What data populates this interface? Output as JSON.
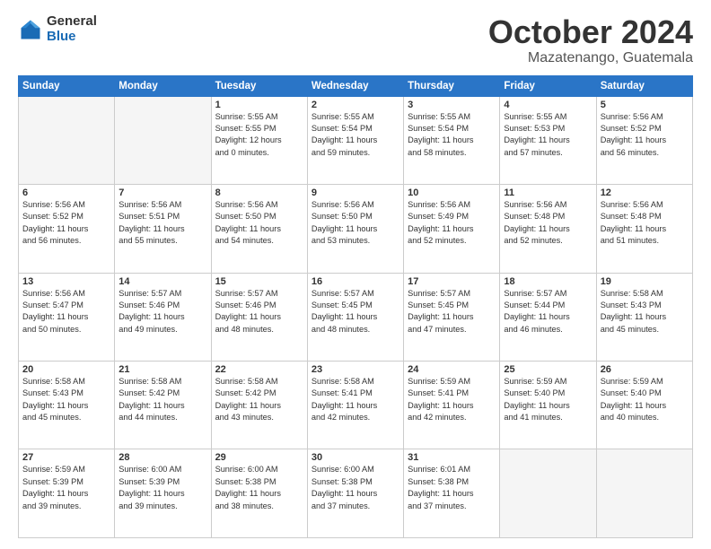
{
  "header": {
    "logo_general": "General",
    "logo_blue": "Blue",
    "month": "October 2024",
    "location": "Mazatenango, Guatemala"
  },
  "weekdays": [
    "Sunday",
    "Monday",
    "Tuesday",
    "Wednesday",
    "Thursday",
    "Friday",
    "Saturday"
  ],
  "weeks": [
    [
      {
        "day": "",
        "info": ""
      },
      {
        "day": "",
        "info": ""
      },
      {
        "day": "1",
        "info": "Sunrise: 5:55 AM\nSunset: 5:55 PM\nDaylight: 12 hours\nand 0 minutes."
      },
      {
        "day": "2",
        "info": "Sunrise: 5:55 AM\nSunset: 5:54 PM\nDaylight: 11 hours\nand 59 minutes."
      },
      {
        "day": "3",
        "info": "Sunrise: 5:55 AM\nSunset: 5:54 PM\nDaylight: 11 hours\nand 58 minutes."
      },
      {
        "day": "4",
        "info": "Sunrise: 5:55 AM\nSunset: 5:53 PM\nDaylight: 11 hours\nand 57 minutes."
      },
      {
        "day": "5",
        "info": "Sunrise: 5:56 AM\nSunset: 5:52 PM\nDaylight: 11 hours\nand 56 minutes."
      }
    ],
    [
      {
        "day": "6",
        "info": "Sunrise: 5:56 AM\nSunset: 5:52 PM\nDaylight: 11 hours\nand 56 minutes."
      },
      {
        "day": "7",
        "info": "Sunrise: 5:56 AM\nSunset: 5:51 PM\nDaylight: 11 hours\nand 55 minutes."
      },
      {
        "day": "8",
        "info": "Sunrise: 5:56 AM\nSunset: 5:50 PM\nDaylight: 11 hours\nand 54 minutes."
      },
      {
        "day": "9",
        "info": "Sunrise: 5:56 AM\nSunset: 5:50 PM\nDaylight: 11 hours\nand 53 minutes."
      },
      {
        "day": "10",
        "info": "Sunrise: 5:56 AM\nSunset: 5:49 PM\nDaylight: 11 hours\nand 52 minutes."
      },
      {
        "day": "11",
        "info": "Sunrise: 5:56 AM\nSunset: 5:48 PM\nDaylight: 11 hours\nand 52 minutes."
      },
      {
        "day": "12",
        "info": "Sunrise: 5:56 AM\nSunset: 5:48 PM\nDaylight: 11 hours\nand 51 minutes."
      }
    ],
    [
      {
        "day": "13",
        "info": "Sunrise: 5:56 AM\nSunset: 5:47 PM\nDaylight: 11 hours\nand 50 minutes."
      },
      {
        "day": "14",
        "info": "Sunrise: 5:57 AM\nSunset: 5:46 PM\nDaylight: 11 hours\nand 49 minutes."
      },
      {
        "day": "15",
        "info": "Sunrise: 5:57 AM\nSunset: 5:46 PM\nDaylight: 11 hours\nand 48 minutes."
      },
      {
        "day": "16",
        "info": "Sunrise: 5:57 AM\nSunset: 5:45 PM\nDaylight: 11 hours\nand 48 minutes."
      },
      {
        "day": "17",
        "info": "Sunrise: 5:57 AM\nSunset: 5:45 PM\nDaylight: 11 hours\nand 47 minutes."
      },
      {
        "day": "18",
        "info": "Sunrise: 5:57 AM\nSunset: 5:44 PM\nDaylight: 11 hours\nand 46 minutes."
      },
      {
        "day": "19",
        "info": "Sunrise: 5:58 AM\nSunset: 5:43 PM\nDaylight: 11 hours\nand 45 minutes."
      }
    ],
    [
      {
        "day": "20",
        "info": "Sunrise: 5:58 AM\nSunset: 5:43 PM\nDaylight: 11 hours\nand 45 minutes."
      },
      {
        "day": "21",
        "info": "Sunrise: 5:58 AM\nSunset: 5:42 PM\nDaylight: 11 hours\nand 44 minutes."
      },
      {
        "day": "22",
        "info": "Sunrise: 5:58 AM\nSunset: 5:42 PM\nDaylight: 11 hours\nand 43 minutes."
      },
      {
        "day": "23",
        "info": "Sunrise: 5:58 AM\nSunset: 5:41 PM\nDaylight: 11 hours\nand 42 minutes."
      },
      {
        "day": "24",
        "info": "Sunrise: 5:59 AM\nSunset: 5:41 PM\nDaylight: 11 hours\nand 42 minutes."
      },
      {
        "day": "25",
        "info": "Sunrise: 5:59 AM\nSunset: 5:40 PM\nDaylight: 11 hours\nand 41 minutes."
      },
      {
        "day": "26",
        "info": "Sunrise: 5:59 AM\nSunset: 5:40 PM\nDaylight: 11 hours\nand 40 minutes."
      }
    ],
    [
      {
        "day": "27",
        "info": "Sunrise: 5:59 AM\nSunset: 5:39 PM\nDaylight: 11 hours\nand 39 minutes."
      },
      {
        "day": "28",
        "info": "Sunrise: 6:00 AM\nSunset: 5:39 PM\nDaylight: 11 hours\nand 39 minutes."
      },
      {
        "day": "29",
        "info": "Sunrise: 6:00 AM\nSunset: 5:38 PM\nDaylight: 11 hours\nand 38 minutes."
      },
      {
        "day": "30",
        "info": "Sunrise: 6:00 AM\nSunset: 5:38 PM\nDaylight: 11 hours\nand 37 minutes."
      },
      {
        "day": "31",
        "info": "Sunrise: 6:01 AM\nSunset: 5:38 PM\nDaylight: 11 hours\nand 37 minutes."
      },
      {
        "day": "",
        "info": ""
      },
      {
        "day": "",
        "info": ""
      }
    ]
  ]
}
